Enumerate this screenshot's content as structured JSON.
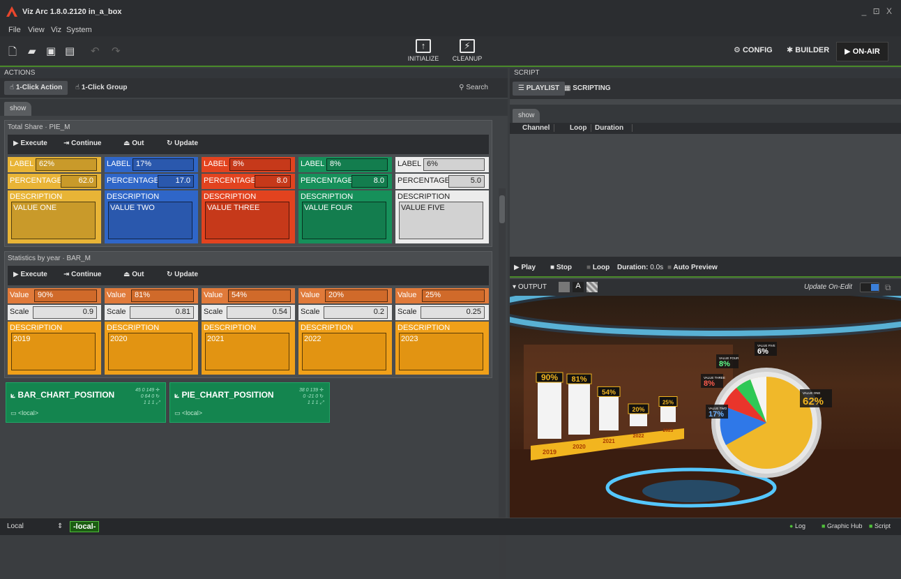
{
  "app": {
    "title": "Viz Arc 1.8.0.2120 in_a_box",
    "window_controls": "_ ⊡ X"
  },
  "menu": [
    "File",
    "View",
    "Viz",
    "System"
  ],
  "toolbar": {
    "initialize_label": "INITIALIZE",
    "cleanup_label": "CLEANUP",
    "config_label": "CONFIG",
    "builder_label": "BUILDER",
    "onair_label": "ON-AIR"
  },
  "actions": {
    "header": "ACTIONS",
    "one_click_action": "1-Click Action",
    "one_click_group": "1-Click Group",
    "search_label": "Search",
    "tab": "show",
    "tools": {
      "execute": "Execute",
      "continue": "Continue",
      "out": "Out",
      "update": "Update"
    },
    "groups": [
      {
        "title": "Total Share · PIE_M",
        "row1_label": "LABEL",
        "row2_label": "PERCENTAGE",
        "row3_label": "DESCRIPTION",
        "cards": [
          {
            "label": "62%",
            "value": "62.0",
            "desc": "VALUE ONE",
            "color": "#e8b436",
            "box": "#c99a2a"
          },
          {
            "label": "17%",
            "value": "17.0",
            "desc": "VALUE TWO",
            "color": "#2f66c8",
            "box": "#2a58ad"
          },
          {
            "label": "8%",
            "value": "8.0",
            "desc": "VALUE THREE",
            "color": "#e2431f",
            "box": "#c6391a"
          },
          {
            "label": "8%",
            "value": "8.0",
            "desc": "VALUE FOUR",
            "color": "#16905a",
            "box": "#137d4e"
          },
          {
            "label": "6%",
            "value": "5.0",
            "desc": "VALUE FIVE",
            "color": "#ececec",
            "box": "#d2d2d2"
          }
        ]
      },
      {
        "title": "Statistics by year · BAR_M",
        "row1_label": "Value",
        "row2_label": "Scale",
        "row3_label": "DESCRIPTION",
        "cards": [
          {
            "label": "90%",
            "value": "0.9",
            "desc": "2019"
          },
          {
            "label": "81%",
            "value": "0.81",
            "desc": "2020"
          },
          {
            "label": "54%",
            "value": "0.54",
            "desc": "2021"
          },
          {
            "label": "20%",
            "value": "0.2",
            "desc": "2022"
          },
          {
            "label": "25%",
            "value": "0.25",
            "desc": "2023"
          }
        ]
      }
    ],
    "positions": [
      {
        "name": "BAR_CHART_POSITION",
        "nums": "45 0 149 ✛\n0 64 0 ↻\n1 1 1 ⤢",
        "loc": "<local>"
      },
      {
        "name": "PIE_CHART_POSITION",
        "nums": "38 0 139 ✛\n0 -21 0 ↻\n1 1 1 ⤢",
        "loc": "<local>"
      }
    ]
  },
  "script": {
    "header": "SCRIPT",
    "playlist": "PLAYLIST",
    "scripting": "SCRIPTING",
    "tab": "show",
    "columns": [
      "Channel",
      "Loop",
      "Duration"
    ],
    "play": "Play",
    "stop": "Stop",
    "loop": "Loop",
    "duration_label": "Duration:",
    "duration_value": "0.0s",
    "auto_preview": "Auto Preview",
    "output_label": "OUTPUT",
    "update_mode": "Update On-Edit"
  },
  "scene": {
    "bars": [
      {
        "pct": "90%",
        "year": "2019",
        "h": 0.9
      },
      {
        "pct": "81%",
        "year": "2020",
        "h": 0.81
      },
      {
        "pct": "54%",
        "year": "2021",
        "h": 0.54
      },
      {
        "pct": "20%",
        "year": "2022",
        "h": 0.2
      },
      {
        "pct": "25%",
        "year": "2023",
        "h": 0.25
      }
    ],
    "pie_labels": [
      {
        "name": "VALUE ONE",
        "pct": "62%"
      },
      {
        "name": "VALUE FIVE",
        "pct": "6%"
      },
      {
        "name": "VALUE FOUR",
        "pct": "8%"
      },
      {
        "name": "VALUE THREE",
        "pct": "8%"
      },
      {
        "name": "VALUE TWO",
        "pct": "17%"
      }
    ]
  },
  "status": {
    "profile": "Local",
    "engine": "-local-",
    "log": "Log",
    "graphic_hub": "Graphic Hub",
    "script": "Script"
  }
}
